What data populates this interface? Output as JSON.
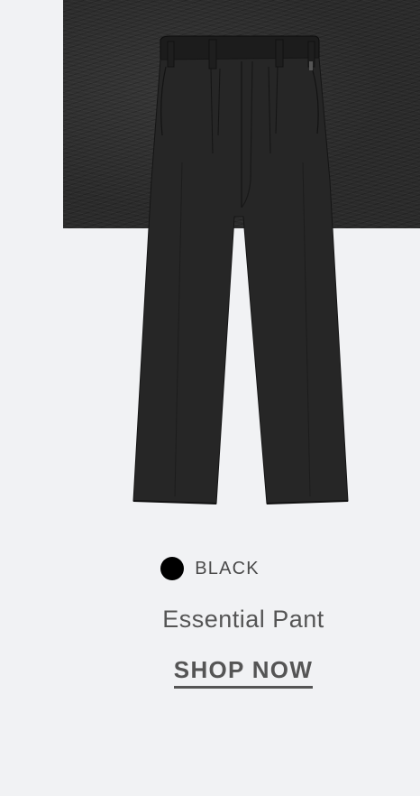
{
  "product": {
    "color_label": "BLACK",
    "color_hex": "#000000",
    "name": "Essential Pant",
    "image_icon": "black-trousers-image",
    "swatch_color": "#2b2b2b"
  },
  "cta": {
    "label": "SHOP NOW"
  }
}
